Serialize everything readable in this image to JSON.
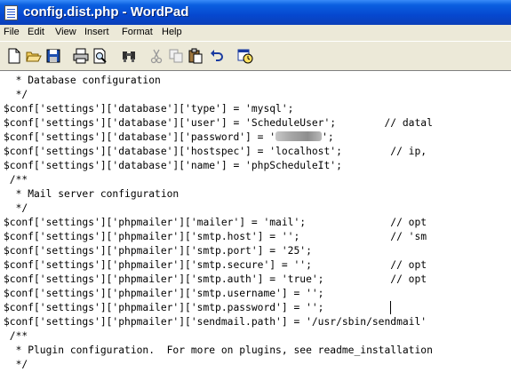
{
  "window": {
    "title": "config.dist.php - WordPad"
  },
  "menu": [
    "File",
    "Edit",
    "View",
    "Insert",
    "Format",
    "Help"
  ],
  "toolbar": {
    "icons": [
      "new-icon",
      "open-icon",
      "save-icon",
      "print-icon",
      "print-preview-icon",
      "find-icon",
      "cut-icon",
      "copy-icon",
      "paste-icon",
      "undo-icon",
      "date-time-icon"
    ]
  },
  "document": {
    "lines": [
      "  * Database configuration",
      "  */",
      "$conf['settings']['database']['type'] = 'mysql';",
      "$conf['settings']['database']['user'] = 'ScheduleUser';        // datal",
      "$conf['settings']['database']['password'] = '",
      "$conf['settings']['database']['hostspec'] = 'localhost';        // ip,",
      "$conf['settings']['database']['name'] = 'phpScheduleIt';",
      " /**",
      "  * Mail server configuration",
      "  */",
      "$conf['settings']['phpmailer']['mailer'] = 'mail';              // opt",
      "$conf['settings']['phpmailer']['smtp.host'] = '';               // 'sm",
      "$conf['settings']['phpmailer']['smtp.port'] = '25';",
      "$conf['settings']['phpmailer']['smtp.secure'] = '';             // opt",
      "$conf['settings']['phpmailer']['smtp.auth'] = 'true';           // opt",
      "$conf['settings']['phpmailer']['smtp.username'] = '';",
      "$conf['settings']['phpmailer']['smtp.password'] = '';",
      "$conf['settings']['phpmailer']['sendmail.path'] = '/usr/sbin/sendmail'",
      " /**",
      "  * Plugin configuration.  For more on plugins, see readme_installation",
      "  */"
    ],
    "redacted_suffix": "';"
  }
}
